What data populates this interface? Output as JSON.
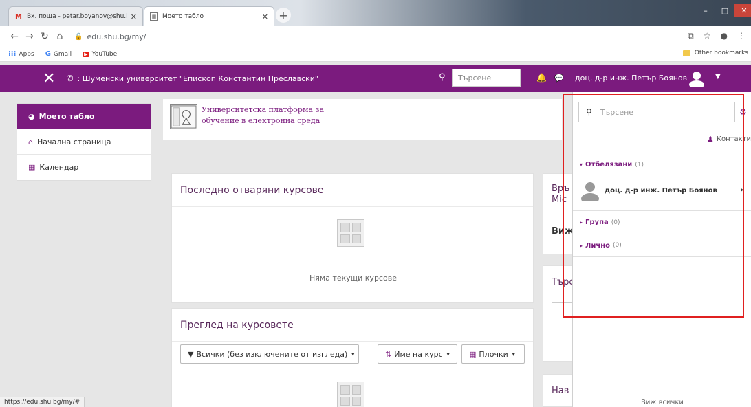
{
  "browser": {
    "tabs": [
      {
        "title": "Вх. поща - petar.boyanov@shu.b",
        "favicon": "gmail-icon"
      },
      {
        "title": "Моето табло",
        "favicon": "moodle-icon"
      }
    ],
    "url": "edu.shu.bg/my/",
    "bookmarks": [
      {
        "label": "Apps",
        "icon": "apps-grid-icon"
      },
      {
        "label": "Gmail",
        "icon": "google-icon"
      },
      {
        "label": "YouTube",
        "icon": "youtube-icon"
      }
    ],
    "other_bookmarks": "Other bookmarks",
    "status_url": "https://edu.shu.bg/my/#"
  },
  "navbar": {
    "site_name": ": Шуменски университет \"Епископ Константин Преславски\"",
    "search_placeholder": "Търсене",
    "user_name": "доц. д-р инж. Петър Боянов",
    "color": "#7b1b7e"
  },
  "sidebar": {
    "items": [
      {
        "label": "Моето табло",
        "icon": "dashboard-icon",
        "active": true
      },
      {
        "label": "Начална страница",
        "icon": "home-icon",
        "active": false
      },
      {
        "label": "Календар",
        "icon": "calendar-icon",
        "active": false
      }
    ]
  },
  "brand": {
    "line1": "Университетска платформа за",
    "line2": "обучение в електронна среда"
  },
  "recent_courses": {
    "title": "Последно отваряни курсове",
    "empty_text": "Няма текущи курсове"
  },
  "course_overview": {
    "title": "Преглед на курсовете",
    "filter_label": "Всички (без изключените от изгледа)",
    "sort_label": "Име на курс",
    "view_label": "Плочки"
  },
  "right_column": {
    "card1_line1": "Връ",
    "card1_line2": "Mic",
    "card1_link": "Виж",
    "card2_title": "Търс",
    "card3_title": "Нав"
  },
  "message_drawer": {
    "search_placeholder": "Търсене",
    "contacts_label": "Контакти",
    "sections": [
      {
        "label": "Отбелязани",
        "count": "(1)",
        "expanded": true
      },
      {
        "label": "Група",
        "count": "(0)",
        "expanded": false
      },
      {
        "label": "Лично",
        "count": "(0)",
        "expanded": false
      }
    ],
    "contact_name": "доц. д-р инж. Петър Боянов",
    "view_all": "Виж всички"
  }
}
